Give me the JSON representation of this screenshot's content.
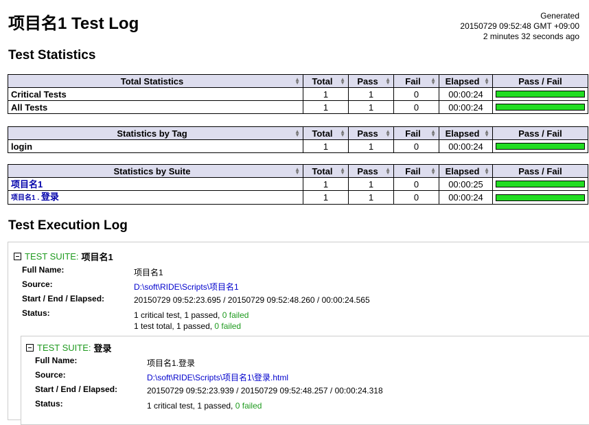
{
  "title": "项目名1 Test Log",
  "generated": {
    "label": "Generated",
    "timestamp": "20150729 09:52:48 GMT +09:00",
    "ago": "2 minutes 32 seconds ago"
  },
  "stats_heading": "Test Statistics",
  "columns": {
    "total": "Total",
    "pass": "Pass",
    "fail": "Fail",
    "elapsed": "Elapsed",
    "passfail": "Pass / Fail"
  },
  "total_stats": {
    "header": "Total Statistics",
    "rows": [
      {
        "name": "Critical Tests",
        "total": "1",
        "pass": "1",
        "fail": "0",
        "elapsed": "00:00:24",
        "pass_ratio": 1.0
      },
      {
        "name": "All Tests",
        "total": "1",
        "pass": "1",
        "fail": "0",
        "elapsed": "00:00:24",
        "pass_ratio": 1.0
      }
    ]
  },
  "tag_stats": {
    "header": "Statistics by Tag",
    "rows": [
      {
        "name": "login",
        "total": "1",
        "pass": "1",
        "fail": "0",
        "elapsed": "00:00:24",
        "pass_ratio": 1.0
      }
    ]
  },
  "suite_stats": {
    "header": "Statistics by Suite",
    "rows": [
      {
        "name": "项目名1",
        "total": "1",
        "pass": "1",
        "fail": "0",
        "elapsed": "00:00:25",
        "pass_ratio": 1.0
      },
      {
        "prefix": "项目名1 . ",
        "name": "登录",
        "total": "1",
        "pass": "1",
        "fail": "0",
        "elapsed": "00:00:24",
        "pass_ratio": 1.0
      }
    ]
  },
  "log_heading": "Test Execution Log",
  "labels": {
    "full_name": "Full Name:",
    "source": "Source:",
    "start_end": "Start / End / Elapsed:",
    "status": "Status:",
    "suite_type": "TEST SUITE:"
  },
  "suite1": {
    "name": "项目名1",
    "full_name": "项目名1",
    "source": "D:\\soft\\RIDE\\Scripts\\项目名1",
    "times": "20150729 09:52:23.695 / 20150729 09:52:48.260 / 00:00:24.565",
    "status_line1_prefix": "1 critical test, 1 passed, ",
    "status_line1_failed": "0 failed",
    "status_line2_prefix": "1 test total, 1 passed, ",
    "status_line2_failed": "0 failed"
  },
  "suite2": {
    "name": "登录",
    "full_name": "项目名1.登录",
    "source": "D:\\soft\\RIDE\\Scripts\\项目名1\\登录.html",
    "times": "20150729 09:52:23.939 / 20150729 09:52:48.257 / 00:00:24.318",
    "status_line1_prefix": "1 critical test, 1 passed, ",
    "status_line1_failed": "0 failed"
  },
  "colors": {
    "pass_bar": "#22dd22",
    "fail_bar": "#dd2200",
    "header_bg": "#ddddee",
    "ok_text": "#1e9a1e",
    "link": "#0000cc"
  }
}
